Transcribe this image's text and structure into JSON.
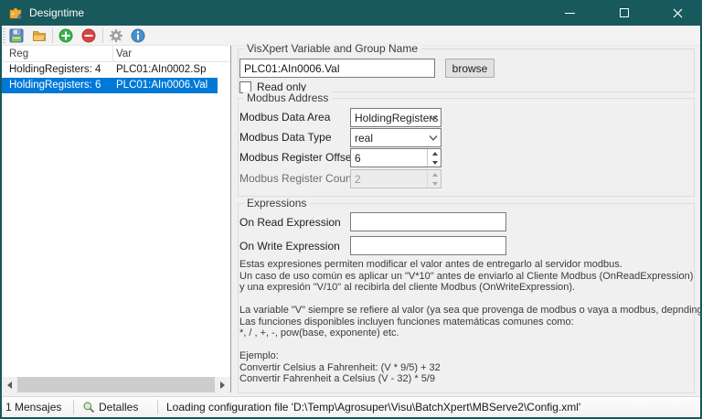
{
  "window": {
    "title": "Designtime"
  },
  "icons": {
    "app": "puzzle-icon",
    "toolbar": [
      "save-floppy-icon",
      "open-folder-icon",
      "add-plus-icon",
      "remove-minus-icon",
      "settings-gear-icon",
      "info-icon"
    ],
    "statusbar": "magnifier-icon",
    "colors": {
      "titlebar": "#17595c",
      "selection": "#0078d7",
      "add_green": "#35b44a",
      "remove_red": "#d64541",
      "info_blue": "#4a90c9",
      "folder_orange": "#f0b44c"
    }
  },
  "list": {
    "columns": [
      "Reg",
      "Var"
    ],
    "rows": [
      {
        "reg": "HoldingRegisters: 4",
        "var": "PLC01:AIn0002.Sp",
        "selected": false
      },
      {
        "reg": "HoldingRegisters: 6",
        "var": "PLC01:AIn0006.Val",
        "selected": true
      }
    ]
  },
  "form": {
    "group_visxpert": {
      "title": "VisXpert Variable and Group Name",
      "variable_value": "PLC01:AIn0006.Val",
      "browse_label": "browse",
      "readonly_label": "Read only",
      "readonly_checked": false
    },
    "group_modbus": {
      "title": "Modbus Address",
      "fields": [
        {
          "label": "Modbus Data Area",
          "value": "HoldingRegisters",
          "type": "combo",
          "enabled": true
        },
        {
          "label": "Modbus Data Type",
          "value": "real",
          "type": "combo",
          "enabled": true
        },
        {
          "label": "Modbus Register Offset",
          "value": "6",
          "type": "spinner",
          "enabled": true
        },
        {
          "label": "Modbus Register Count",
          "value": "2",
          "type": "spinner",
          "enabled": false
        }
      ]
    },
    "group_expressions": {
      "title": "Expressions",
      "on_read_label": "On Read Expression",
      "on_read_value": "",
      "on_write_label": "On Write Expression",
      "on_write_value": "",
      "help_lines": [
        "Estas expresiones permiten modificar el valor antes de entregarlo al servidor modbus.",
        "Un caso de uso común es aplicar un \"V*10\" antes de enviarlo al Cliente Modbus (OnReadExpression)",
        "y una expresión \"V/10\" al recibirla del cliente Modbus (OnWriteExpression).",
        "",
        "La variable \"V\" siempre se refiere al valor (ya sea que provenga de modbus o vaya a modbus, depnding en Read/Write).",
        "Las funciones disponibles incluyen funciones matemáticas comunes como:",
        "*, / , +, -, pow(base, exponente) etc.",
        "",
        "Ejemplo:",
        "Convertir Celsius a Fahrenheit: (V * 9/5) + 32",
        "Convertir Fahrenheit a Celsius (V - 32) * 5/9"
      ]
    }
  },
  "statusbar": {
    "messages": "1 Mensajes",
    "details": "Detalles",
    "status": "Loading configuration file 'D:\\Temp\\Agrosuper\\Visu\\BatchXpert\\MBServe2\\Config.xml'"
  }
}
